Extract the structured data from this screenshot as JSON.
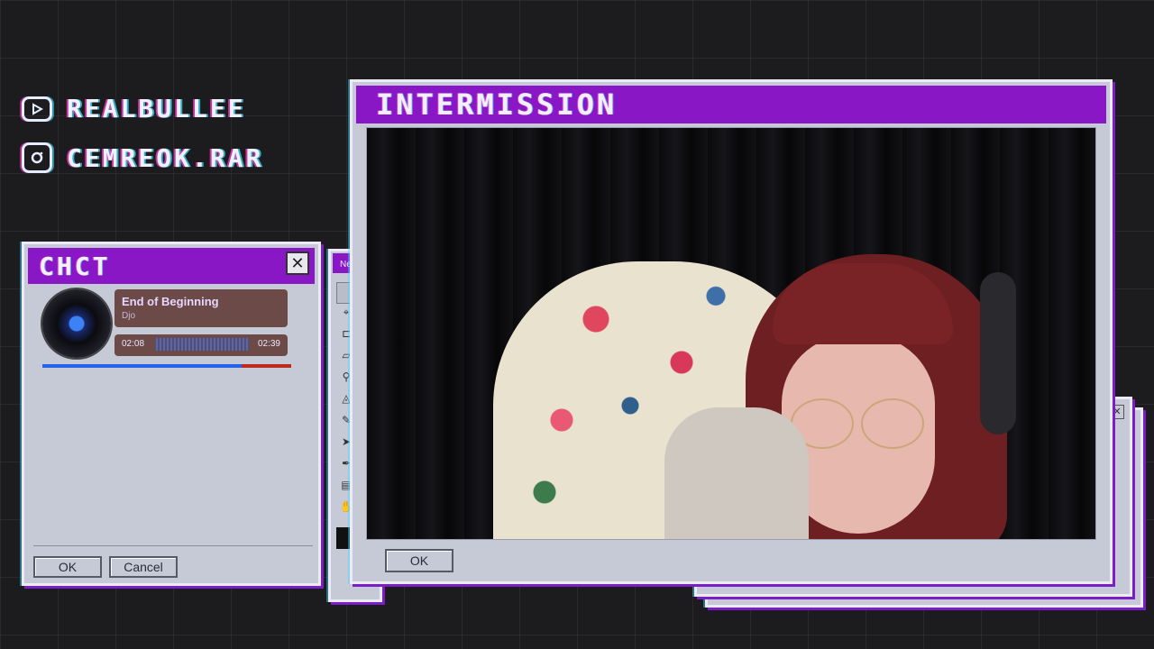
{
  "social": {
    "youtube": {
      "icon": "youtube-icon",
      "handle": "REALBULLEE"
    },
    "instagram": {
      "icon": "instagram-icon",
      "handle": "CEMREOK.RAR"
    }
  },
  "chat_window": {
    "title": "CHCT",
    "close_icon": "close-icon",
    "ok_label": "OK",
    "cancel_label": "Cancel"
  },
  "now_playing": {
    "track": "End of Beginning",
    "artist": "Djo",
    "elapsed": "02:08",
    "duration": "02:39",
    "progress_fraction": 0.8
  },
  "paint_window": {
    "title": "Ne"
  },
  "main_window": {
    "title": "INTERMISSION",
    "ok_label": "OK",
    "content": "webcam-feed"
  },
  "colors": {
    "accent_purple": "#8a17c6",
    "window_gray": "#c6c9d6",
    "progress_blue": "#2563eb",
    "progress_red": "#c0291d",
    "player_bg": "#6b4a47"
  }
}
